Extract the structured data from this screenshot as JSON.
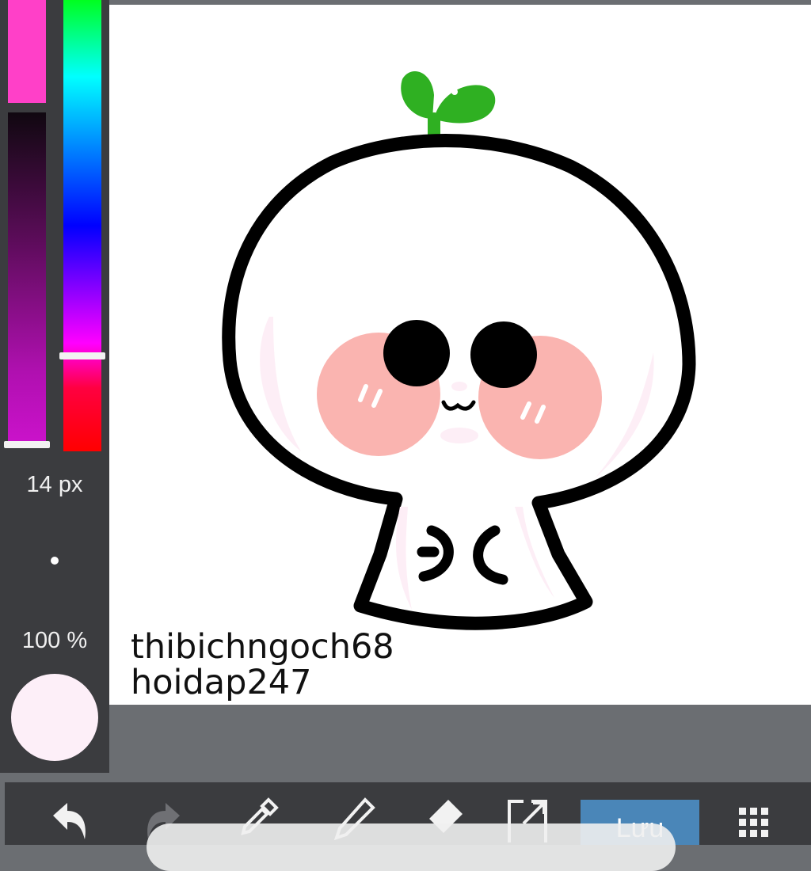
{
  "brush": {
    "size_label": "14 px",
    "opacity_label": "100 %"
  },
  "current_color": "#fdeff8",
  "canvas": {
    "watermark_line1": "thibichngoch68",
    "watermark_line2": "hoidap247"
  },
  "toolbar": {
    "tools": [
      "undo-icon",
      "redo-icon",
      "eyedropper-icon",
      "pen-icon",
      "eraser-icon",
      "fullscreen-icon",
      "grid-menu-icon"
    ],
    "save_label": "Lưu"
  }
}
